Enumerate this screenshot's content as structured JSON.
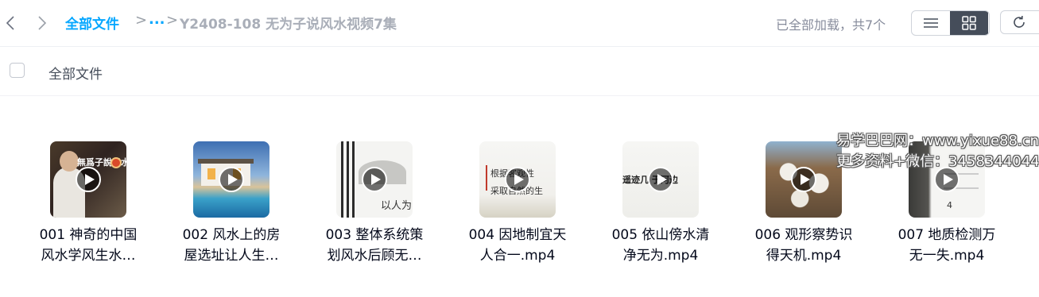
{
  "nav": {
    "back_icon": "chevron-left-icon",
    "forward_icon": "chevron-right-icon"
  },
  "breadcrumb": {
    "root": "全部文件",
    "separator": ">",
    "ellipsis": "...",
    "current": "Y2408-108 无为子说风水视频7集"
  },
  "toolbar": {
    "status": "已全部加载，共7个",
    "list_view_icon": "list-icon",
    "grid_view_icon": "grid-icon",
    "refresh_icon": "refresh-icon"
  },
  "subbar": {
    "title": "全部文件"
  },
  "files": [
    {
      "line1": "001 神奇的中国",
      "line2": "风水学风生水…",
      "thumb_text": "無爲子說風水"
    },
    {
      "line1": "002 风水上的房",
      "line2": "屋选址让人生…"
    },
    {
      "line1": "003 整体系统策",
      "line2": "划风水后顾无…",
      "thumb_text": "以人为"
    },
    {
      "line1": "004 因地制宜天",
      "line2": "人合一.mp4",
      "thumb_text_1": "根据客观性",
      "thumb_text_2": "采取自然的生"
    },
    {
      "line1": "005 依山傍水清",
      "line2": "净无为.mp4",
      "thumb_text": "遥迹几 于河边"
    },
    {
      "line1": "006 观形察势识",
      "line2": "得天机.mp4"
    },
    {
      "line1": "007 地质检测万",
      "line2": "无一失.mp4",
      "thumb_text": "4"
    }
  ],
  "watermark": {
    "line1": "易学巴巴网：www.yixue88.cn",
    "line2": "更多资料+微信：3458344044"
  },
  "colors": {
    "accent": "#06a7ff",
    "text": "#03081a",
    "muted": "#878c9c"
  }
}
